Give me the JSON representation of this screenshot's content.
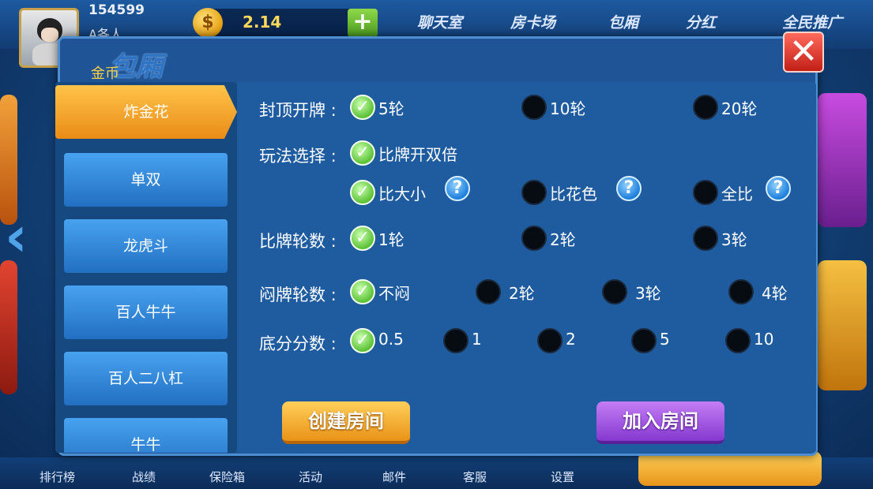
{
  "header": {
    "user_id": "154599",
    "user_name": "A各人",
    "coin_symbol": "$",
    "coin_amount": "2.14",
    "plus_label": "+",
    "nav": [
      "聊天室",
      "房卡场",
      "包厢",
      "分红",
      "全民推广"
    ]
  },
  "dialog": {
    "title": "包厢",
    "coin_label": "金币",
    "close_label": "✕"
  },
  "game_tabs": [
    "炸金花",
    "单双",
    "龙虎斗",
    "百人牛牛",
    "百人二八杠",
    "牛牛"
  ],
  "active_tab": "炸金花",
  "options": {
    "cap_rounds": {
      "label": "封顶开牌 :",
      "choices": [
        "5轮",
        "10轮",
        "20轮"
      ],
      "selected": "5轮"
    },
    "play_mode": {
      "label": "玩法选择 :",
      "double_label": "比牌开双倍",
      "choices": [
        "比大小",
        "比花色",
        "全比"
      ],
      "selected": "比大小"
    },
    "compare_rounds": {
      "label": "比牌轮数 :",
      "choices": [
        "1轮",
        "2轮",
        "3轮"
      ],
      "selected": "1轮"
    },
    "blind_rounds": {
      "label": "闷牌轮数 :",
      "choices": [
        "不闷",
        "2轮",
        "3轮",
        "4轮"
      ],
      "selected": "不闷"
    },
    "base_score": {
      "label": "底分分数 :",
      "choices": [
        "0.5",
        "1",
        "2",
        "5",
        "10"
      ],
      "selected": "0.5"
    }
  },
  "help_label": "?",
  "check_mark": "✓",
  "actions": {
    "create": "创建房间",
    "join": "加入房间"
  },
  "footer": {
    "nav": [
      "排行榜",
      "战绩",
      "保险箱",
      "活动",
      "邮件",
      "客服",
      "设置"
    ]
  },
  "colors": {
    "accent_orange": "#e98c16",
    "accent_purple": "#8539d0",
    "check_green": "#5cc235"
  }
}
